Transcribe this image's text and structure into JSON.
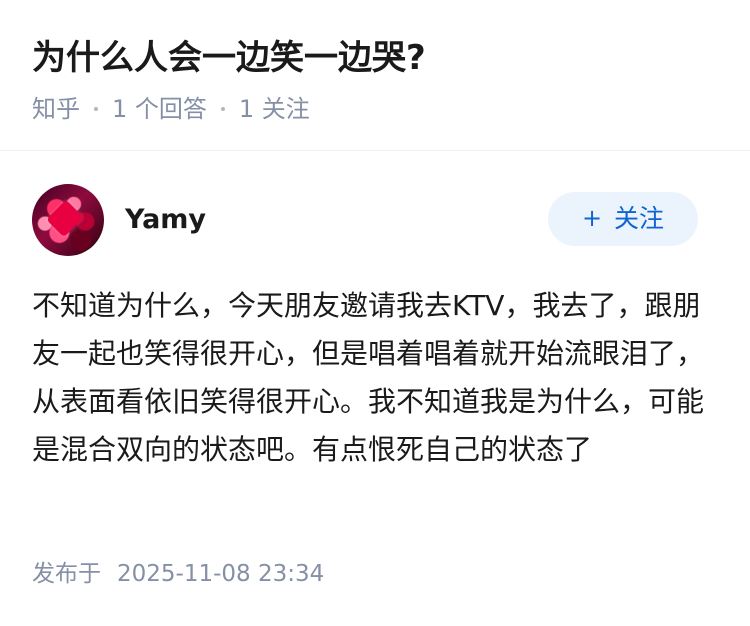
{
  "question": {
    "title": "为什么人会一边笑一边哭?",
    "meta": {
      "source": "知乎",
      "answers": "1 个回答",
      "followers": "1 关注"
    }
  },
  "answer": {
    "author": {
      "name": "Yamy",
      "avatar_icon": "profile-avatar-icon"
    },
    "follow_button": {
      "icon": "plus-icon",
      "icon_text": "+",
      "label": "关注"
    },
    "content": "不知道为什么，今天朋友邀请我去KTV，我去了，跟朋友一起也笑得很开心，但是唱着唱着就开始流眼泪了，从表面看依旧笑得很开心。我不知道我是为什么，可能是混合双向的状态吧。有点恨死自己的状态了",
    "published": {
      "label": "发布于",
      "datetime": "2025-11-08 23:34"
    }
  },
  "colors": {
    "text": "#1a1a1a",
    "secondary_text": "#8590a6",
    "accent": "#0f64d2",
    "button_background": "#ebf4fd"
  }
}
